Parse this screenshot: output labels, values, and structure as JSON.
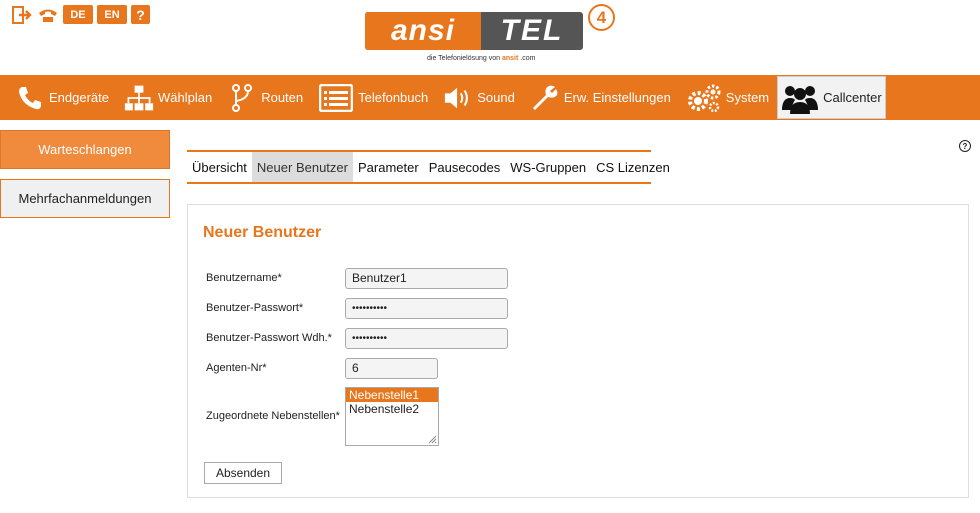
{
  "topbar": {
    "logout_icon": "exit-icon",
    "phone_icon": "phone-icon",
    "lang_de": "DE",
    "lang_en": "EN",
    "help": "?"
  },
  "logo": {
    "left": "ansi",
    "right": "TEL",
    "version": "4",
    "tagline_prefix": "die Telefonielösung von",
    "tagline_brand": "ansit",
    "tagline_suffix": "com"
  },
  "nav": {
    "items": [
      {
        "label": "Endgeräte",
        "icon": "phone-handset-icon"
      },
      {
        "label": "Wählplan",
        "icon": "sitemap-icon"
      },
      {
        "label": "Routen",
        "icon": "route-icon"
      },
      {
        "label": "Telefonbuch",
        "icon": "addressbook-icon"
      },
      {
        "label": "Sound",
        "icon": "speaker-icon"
      },
      {
        "label": "Erw. Einstellungen",
        "icon": "wrench-icon"
      },
      {
        "label": "System",
        "icon": "gears-icon"
      },
      {
        "label": "Callcenter",
        "icon": "users-icon"
      }
    ],
    "active": "Callcenter"
  },
  "sidebar": {
    "items": [
      {
        "label": "Warteschlangen",
        "active": true
      },
      {
        "label": "Mehrfachanmeldungen",
        "active": false
      }
    ]
  },
  "tabs": {
    "items": [
      "Übersicht",
      "Neuer Benutzer",
      "Parameter",
      "Pausecodes",
      "WS-Gruppen",
      "CS Lizenzen"
    ],
    "active": "Neuer Benutzer"
  },
  "help_icon": "?",
  "form": {
    "title": "Neuer Benutzer",
    "username_label": "Benutzername*",
    "username_value": "Benutzer1",
    "password_label": "Benutzer-Passwort*",
    "password_value": "••••••••••",
    "password2_label": "Benutzer-Passwort Wdh.*",
    "password2_value": "••••••••••",
    "agent_label": "Agenten-Nr*",
    "agent_value": "6",
    "extensions_label": "Zugeordnete Nebenstellen*",
    "extensions": [
      "Nebenstelle1",
      "Nebenstelle2"
    ],
    "extensions_selected": "Nebenstelle1",
    "submit_label": "Absenden"
  },
  "colors": {
    "accent": "#e8761c",
    "logo_dark": "#555555"
  }
}
